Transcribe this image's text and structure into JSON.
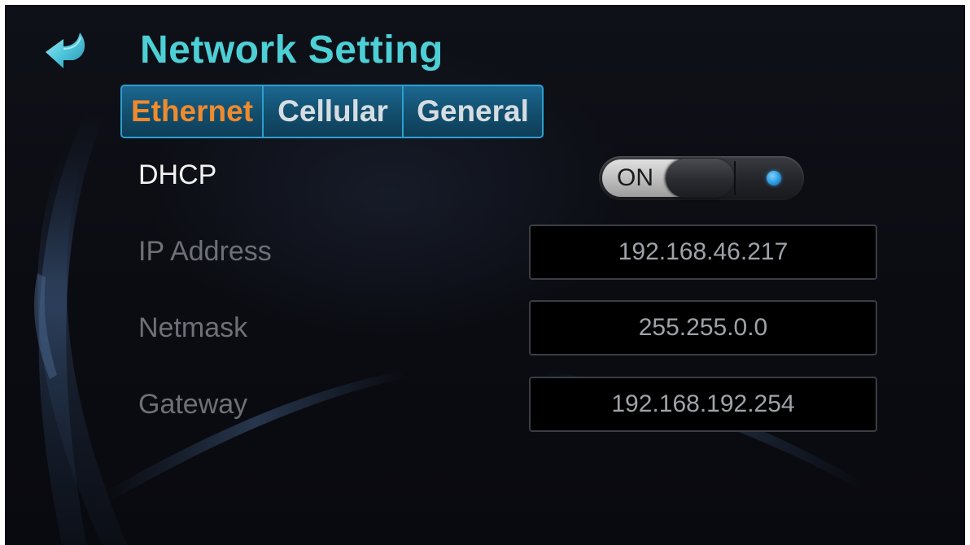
{
  "header": {
    "title": "Network Setting",
    "back_icon": "back-arrow-icon"
  },
  "tabs": [
    {
      "label": "Ethernet",
      "active": true
    },
    {
      "label": "Cellular",
      "active": false
    },
    {
      "label": "General",
      "active": false
    }
  ],
  "ethernet": {
    "dhcp": {
      "label": "DHCP",
      "state": "ON",
      "enabled": true
    },
    "ip_address": {
      "label": "IP Address",
      "value": "192.168.46.217"
    },
    "netmask": {
      "label": "Netmask",
      "value": "255.255.0.0"
    },
    "gateway": {
      "label": "Gateway",
      "value": "192.168.192.254"
    }
  },
  "colors": {
    "title": "#4cd0d6",
    "active_tab": "#f08a2e",
    "tab_border": "#2e9fd0",
    "toggle_led": "#2a9ae0"
  }
}
